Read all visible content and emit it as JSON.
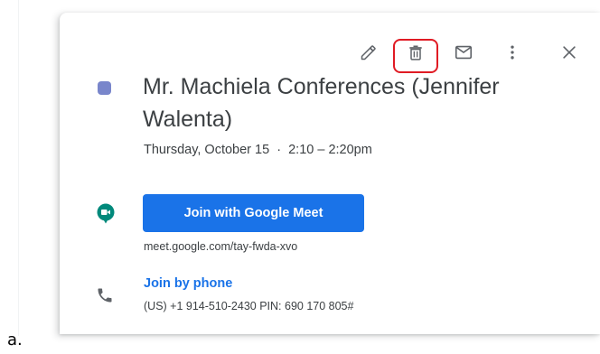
{
  "toolbar": {
    "icons": [
      "edit-icon",
      "trash-icon",
      "mail-icon",
      "more-vert-icon",
      "close-icon"
    ],
    "highlight_color": "#e01b24"
  },
  "event": {
    "color": "#7986cb",
    "title": "Mr. Machiela Conferences (Jennifer Walenta)",
    "datetime": "Thursday, October 15  ·  2:10 – 2:20pm"
  },
  "meet": {
    "icon": "google-meet-icon",
    "button_label": "Join with Google Meet",
    "url": "meet.google.com/tay-fwda-xvo",
    "accent": "#1a73e8"
  },
  "phone": {
    "icon": "phone-icon",
    "link_label": "Join by phone",
    "details": "(US) +1 914-510-2430 PIN: 690 170 805#"
  },
  "caption": "a."
}
